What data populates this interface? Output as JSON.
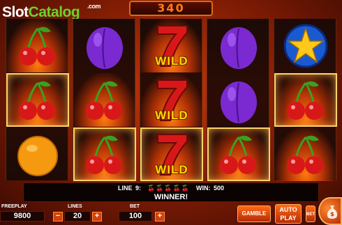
{
  "header": {
    "logo_slot": "Slot",
    "logo_catalog": "Catalog",
    "logo_com": ".com",
    "top_counter": "340"
  },
  "reels": [
    [
      "cherry-icon",
      "cherry-icon",
      "orange-icon"
    ],
    [
      "plum-icon",
      "cherry-icon",
      "cherry-icon"
    ],
    [
      "seven-wild-icon",
      "seven-wild-icon",
      "seven-wild-icon"
    ],
    [
      "plum-icon",
      "plum-icon",
      "cherry-icon"
    ],
    [
      "star-icon",
      "cherry-icon",
      "cherry-icon"
    ]
  ],
  "symbols": {
    "wild_label": "WILD"
  },
  "win_bar": {
    "line_text": "LINE 9:",
    "cherries": "🍒🍒🍒🍒🍒",
    "win_text": "WIN: 500",
    "status": "WINNER!"
  },
  "controls": {
    "freeplay_label": "FREEPLAY",
    "freeplay_value": "9800",
    "lines_label": "LINES",
    "lines_value": "20",
    "bet_label": "BET",
    "bet_value": "100",
    "gamble_label": "GAMBLE",
    "autoplay_label": "AUTO PLAY",
    "minus": "−",
    "plus": "+"
  },
  "colors": {
    "accent": "#ff6a18",
    "gold": "#ffd700",
    "cherry_red": "#d81818",
    "leaf_green": "#3aa020",
    "plum_purple": "#7a2ad0",
    "orange": "#f59a10",
    "star_blue": "#1a5ad0"
  }
}
